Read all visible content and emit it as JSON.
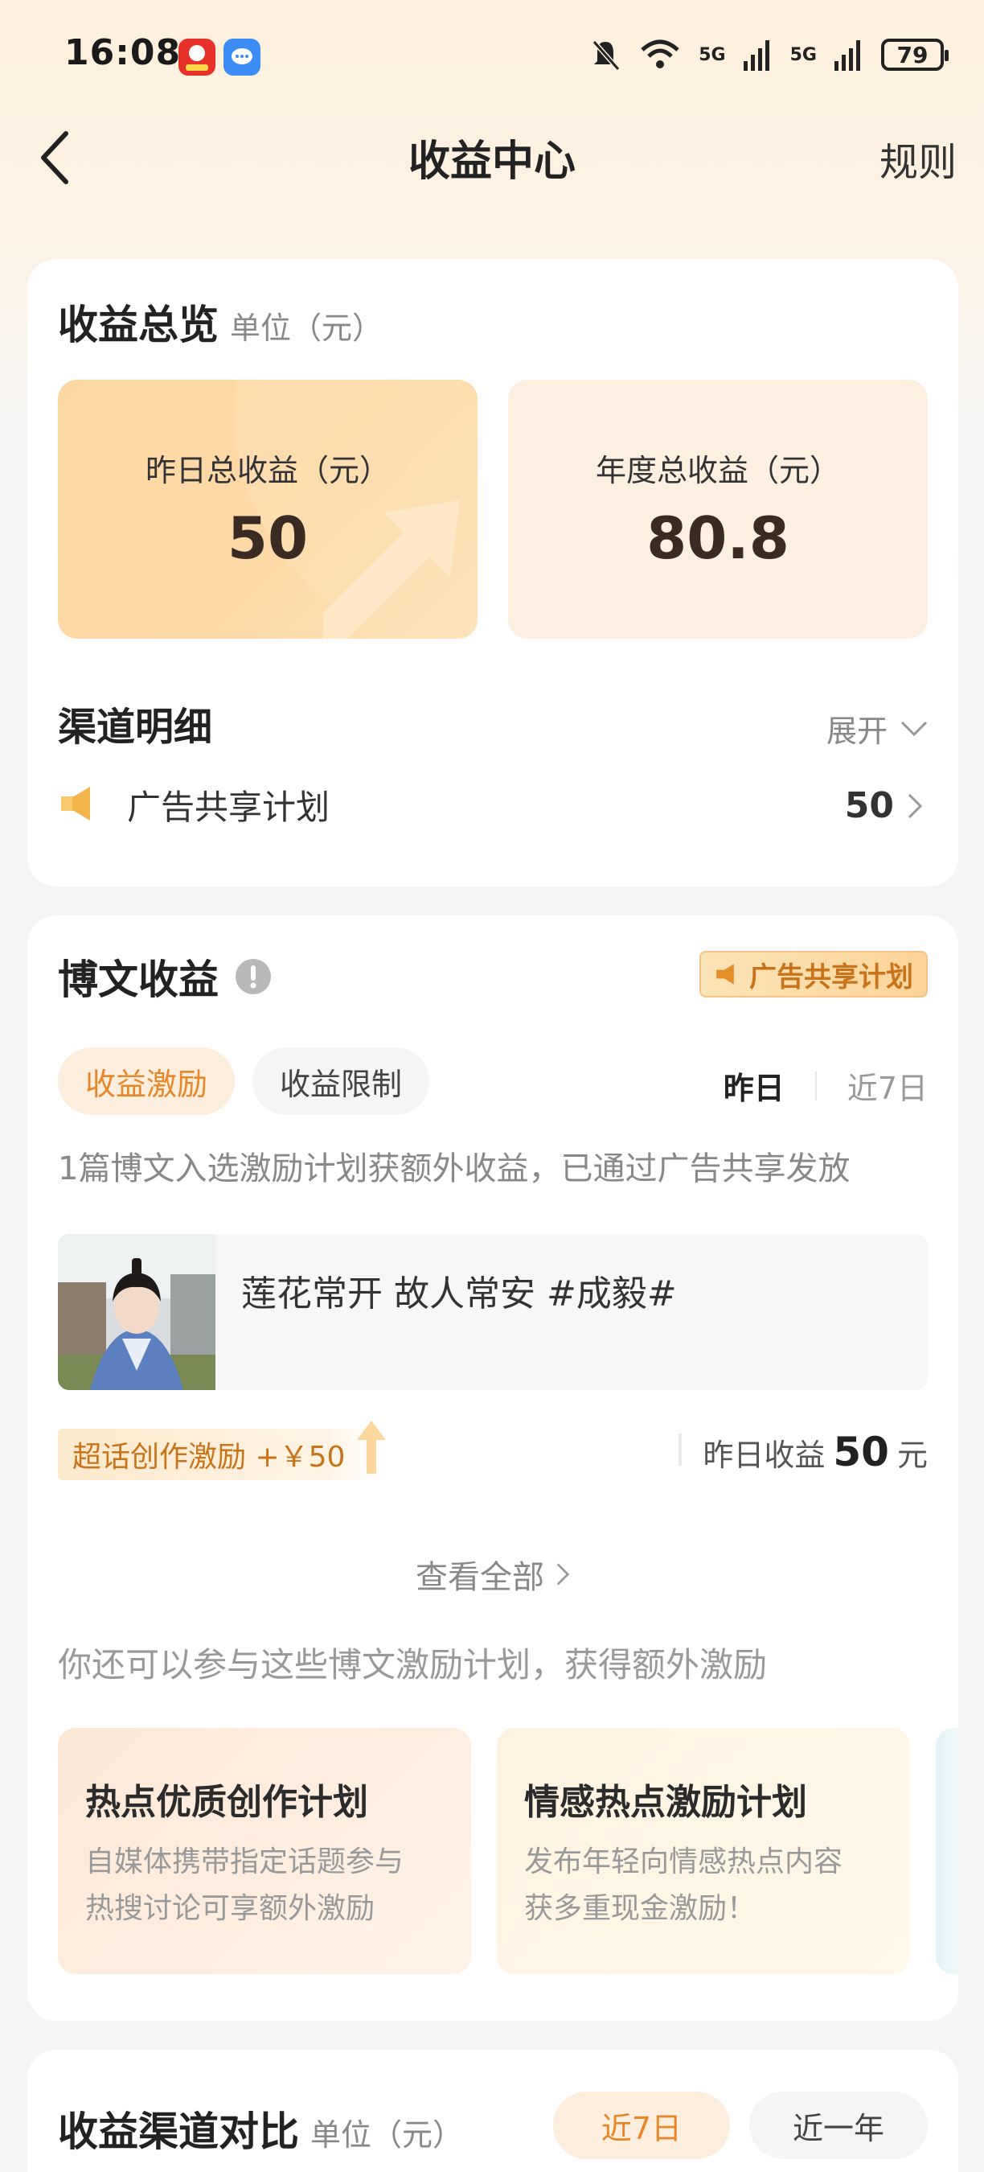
{
  "status_bar": {
    "time": "16:08",
    "network_1": "5G",
    "network_2": "5G",
    "battery": "79",
    "icons": [
      "app-618-icon",
      "message-app-icon",
      "mute-bell-icon",
      "wifi-icon",
      "signal-icon",
      "battery-icon"
    ]
  },
  "nav": {
    "title": "收益中心",
    "rules_label": "规则"
  },
  "overview": {
    "title": "收益总览",
    "unit": "单位（元）",
    "yesterday_label": "昨日总收益（元）",
    "yesterday_value": "50",
    "annual_label": "年度总收益（元）",
    "annual_value": "80.8",
    "channel_title": "渠道明细",
    "expand_label": "展开",
    "channels": [
      {
        "name": "广告共享计划",
        "value": "50",
        "icon": "megaphone-icon"
      }
    ]
  },
  "post_income": {
    "title": "博文收益",
    "badge": "广告共享计划",
    "tabs": [
      "收益激励",
      "收益限制"
    ],
    "active_tab": "收益激励",
    "periods": [
      "昨日",
      "近7日"
    ],
    "active_period": "昨日",
    "description": "1篇博文入选激励计划获额外收益，已通过广告共享发放",
    "post": {
      "text": "莲花常开 故人常安 #成毅#",
      "reward_tag": "超话创作激励 +￥50",
      "earn_label": "昨日收益",
      "earn_value": "50",
      "earn_unit": "元"
    },
    "view_all": "查看全部",
    "more_hint": "你还可以参与这些博文激励计划，获得额外激励",
    "plans": [
      {
        "title": "热点优质创作计划",
        "desc_line1": "自媒体携带指定话题参与",
        "desc_line2": "热搜讨论可享额外激励"
      },
      {
        "title": "情感热点激励计划",
        "desc_line1": "发布年轻向情感热点内容",
        "desc_line2": "获多重现金激励！"
      }
    ]
  },
  "compare": {
    "title": "收益渠道对比",
    "unit": "单位（元）",
    "periods": [
      "近7日",
      "近一年"
    ],
    "active_period": "近7日"
  },
  "colors": {
    "accent_orange": "#e8862a",
    "pill_active_bg": "#fdeedd",
    "pill_bg": "#f5f5f5",
    "stat_left_bg": "#fdd39a",
    "stat_right_bg": "#fdf0e0"
  }
}
